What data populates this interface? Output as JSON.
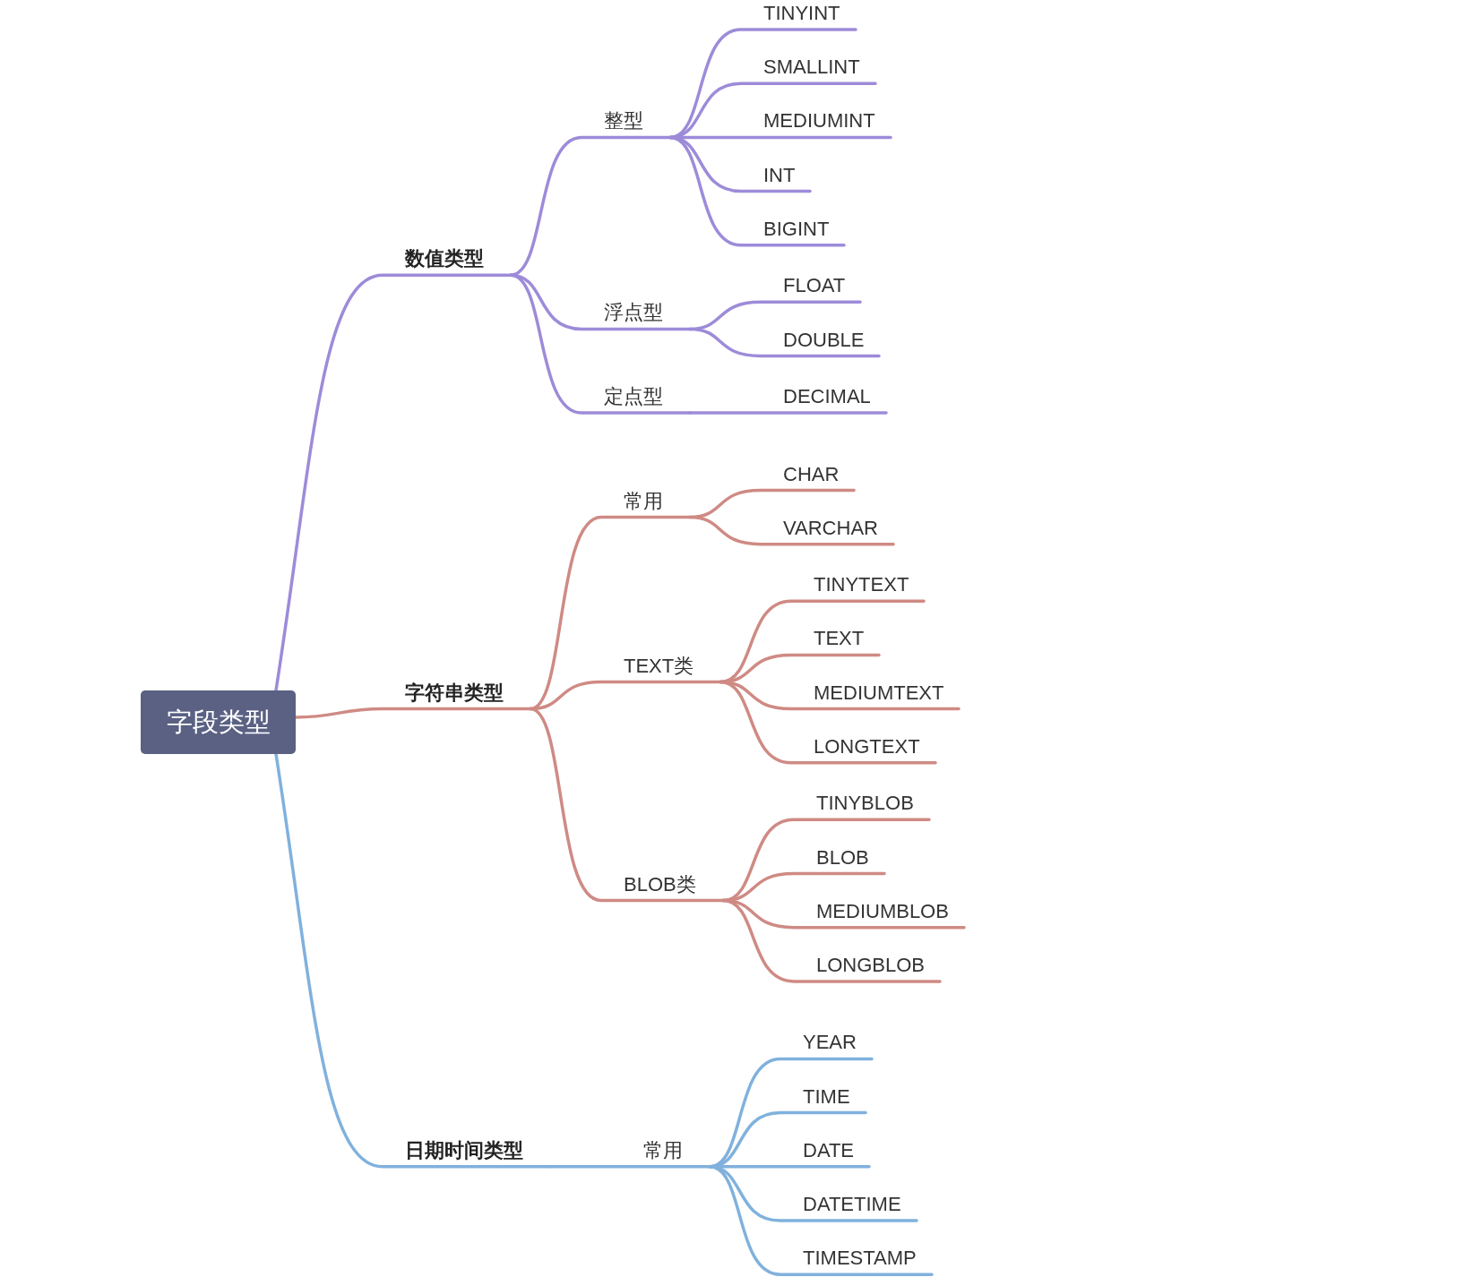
{
  "root": {
    "label": "字段类型",
    "branches": [
      {
        "label": "数值类型",
        "color": "#9d8bd9",
        "children": [
          {
            "label": "整型",
            "children": [
              {
                "label": "TINYINT"
              },
              {
                "label": "SMALLINT"
              },
              {
                "label": "MEDIUMINT"
              },
              {
                "label": "INT"
              },
              {
                "label": "BIGINT"
              }
            ]
          },
          {
            "label": "浮点型",
            "children": [
              {
                "label": "FLOAT"
              },
              {
                "label": "DOUBLE"
              }
            ]
          },
          {
            "label": "定点型",
            "children": [
              {
                "label": "DECIMAL"
              }
            ]
          }
        ]
      },
      {
        "label": "字符串类型",
        "color": "#cf8a84",
        "children": [
          {
            "label": "常用",
            "children": [
              {
                "label": "CHAR"
              },
              {
                "label": "VARCHAR"
              }
            ]
          },
          {
            "label": "TEXT类",
            "children": [
              {
                "label": "TINYTEXT"
              },
              {
                "label": "TEXT"
              },
              {
                "label": "MEDIUMTEXT"
              },
              {
                "label": "LONGTEXT"
              }
            ]
          },
          {
            "label": "BLOB类",
            "children": [
              {
                "label": "TINYBLOB"
              },
              {
                "label": "BLOB"
              },
              {
                "label": "MEDIUMBLOB"
              },
              {
                "label": "LONGBLOB"
              }
            ]
          }
        ]
      },
      {
        "label": "日期时间类型",
        "color": "#80b1dd",
        "children": [
          {
            "label": "常用",
            "children": [
              {
                "label": "YEAR"
              },
              {
                "label": "TIME"
              },
              {
                "label": "DATE"
              },
              {
                "label": "DATETIME"
              },
              {
                "label": "TIMESTAMP"
              }
            ]
          }
        ]
      }
    ]
  }
}
